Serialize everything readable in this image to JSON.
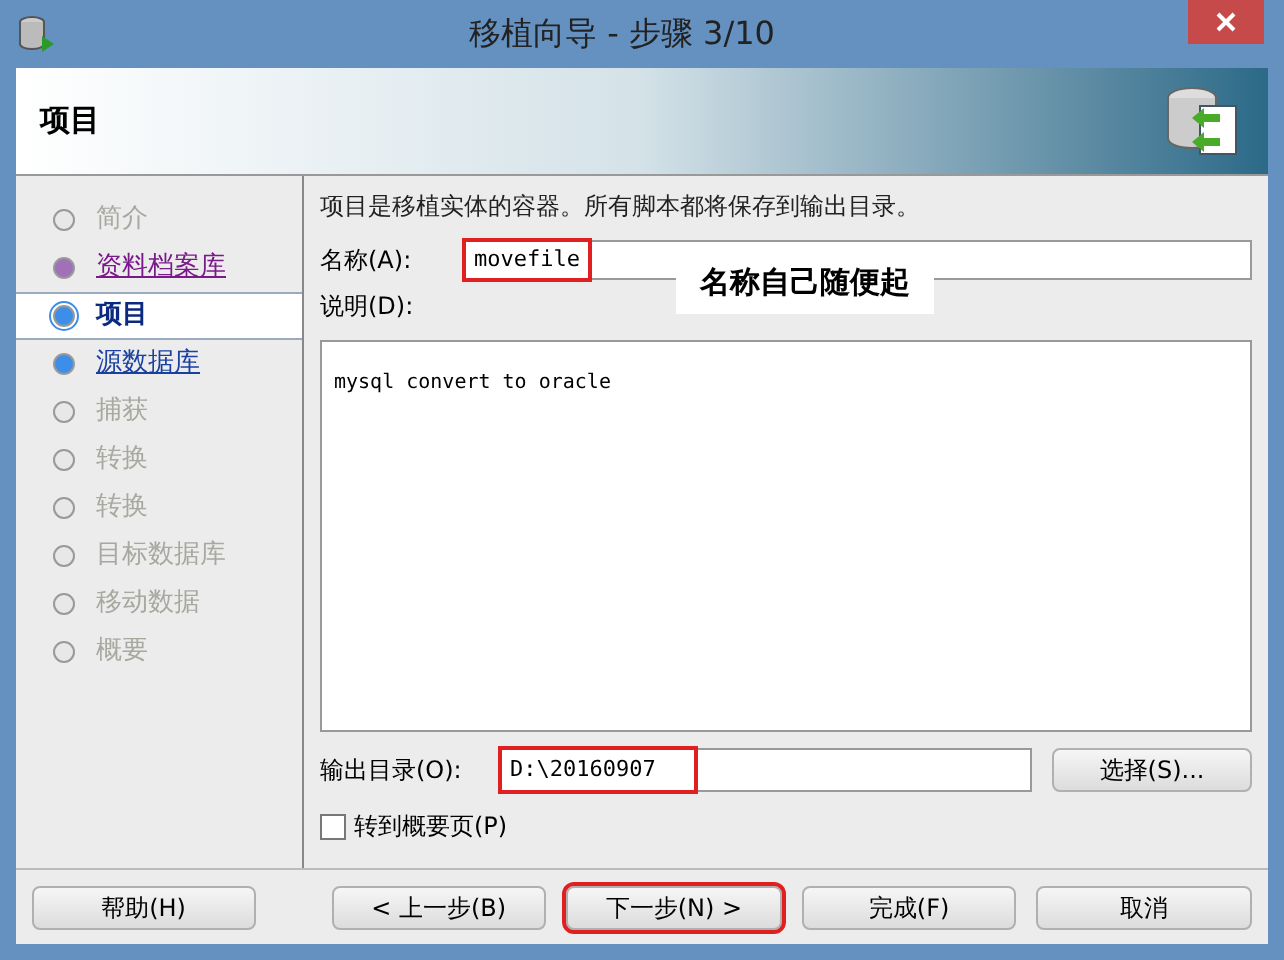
{
  "window": {
    "title": "移植向导 - 步骤 3/10"
  },
  "header": {
    "title": "项目"
  },
  "steps": [
    {
      "label": "简介",
      "kind": "disabled",
      "selected": false
    },
    {
      "label": "资料档案库",
      "kind": "visited",
      "selected": false
    },
    {
      "label": "项目",
      "kind": "current",
      "selected": true
    },
    {
      "label": "源数据库",
      "kind": "link",
      "selected": false
    },
    {
      "label": "捕获",
      "kind": "disabled",
      "selected": false
    },
    {
      "label": "转换",
      "kind": "disabled",
      "selected": false
    },
    {
      "label": "转换",
      "kind": "disabled",
      "selected": false
    },
    {
      "label": "目标数据库",
      "kind": "disabled",
      "selected": false
    },
    {
      "label": "移动数据",
      "kind": "disabled",
      "selected": false
    },
    {
      "label": "概要",
      "kind": "disabled",
      "selected": false
    }
  ],
  "intro": "项目是移植实体的容器。所有脚本都将保存到输出目录。",
  "name_field": {
    "label": "名称(A):",
    "value": "movefile",
    "highlighted": true
  },
  "annotation": "名称自己随便起",
  "description_field": {
    "label": "说明(D):",
    "value": "mysql convert to oracle"
  },
  "output_field": {
    "label": "输出目录(O):",
    "value": "D:\\20160907",
    "highlighted": true
  },
  "choose_button": "选择(S)...",
  "summary_checkbox": {
    "label": "转到概要页(P)",
    "checked": false
  },
  "buttons": [
    {
      "label": "帮助(H)",
      "highlighted": false
    },
    {
      "label": "< 上一步(B)",
      "highlighted": false
    },
    {
      "label": "下一步(N) >",
      "highlighted": true
    },
    {
      "label": "完成(F)",
      "highlighted": false
    },
    {
      "label": "取消",
      "highlighted": false
    }
  ]
}
